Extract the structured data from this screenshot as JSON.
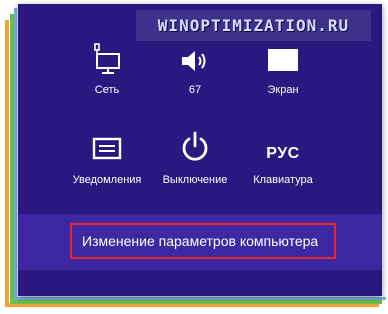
{
  "watermark": {
    "text": "WINOPTIMIZATION.RU"
  },
  "tiles": {
    "network": {
      "label": "Сеть",
      "icon": "network-monitor-icon"
    },
    "volume": {
      "label": "67",
      "icon": "speaker-icon"
    },
    "screen": {
      "label": "Экран",
      "icon": "screen-icon"
    },
    "notifications": {
      "label": "Уведомления",
      "icon": "notifications-icon"
    },
    "power": {
      "label": "Выключение",
      "icon": "power-icon"
    },
    "keyboard": {
      "label": "Клавиатура",
      "glyph": "РУС"
    }
  },
  "settings_link": {
    "label": "Изменение параметров компьютера"
  },
  "colors": {
    "panel": "#2a1780",
    "band": "#3d28a2",
    "highlight_border": "#e6262b"
  }
}
